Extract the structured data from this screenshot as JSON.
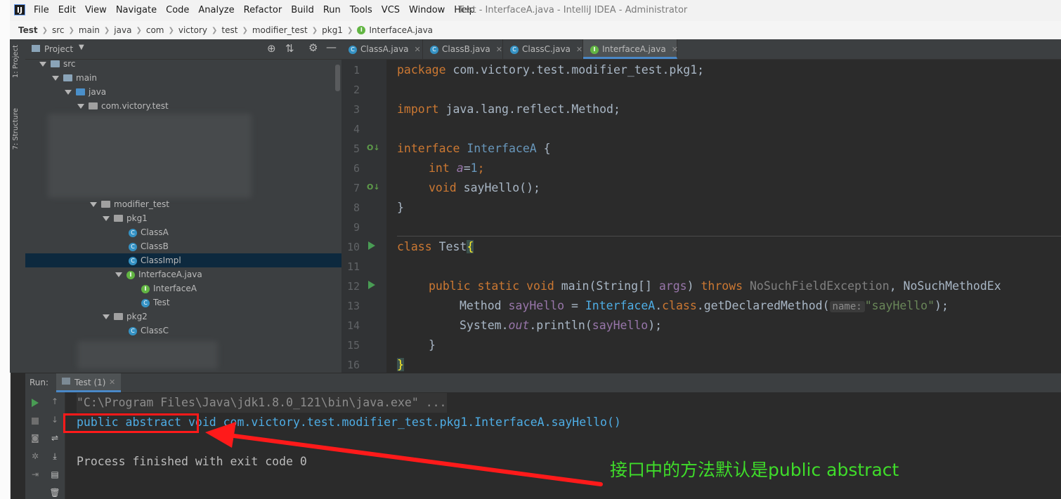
{
  "app": {
    "icon_letter": "IJ",
    "window_title": "Test - InterfaceA.java - IntelliJ IDEA - Administrator"
  },
  "menu": [
    "File",
    "Edit",
    "View",
    "Navigate",
    "Code",
    "Analyze",
    "Refactor",
    "Build",
    "Run",
    "Tools",
    "VCS",
    "Window",
    "Help"
  ],
  "breadcrumb": [
    "Test",
    "src",
    "main",
    "java",
    "com",
    "victory",
    "test",
    "modifier_test",
    "pkg1",
    "InterfaceA.java"
  ],
  "side_tabs": [
    "1: Project",
    "7: Structure"
  ],
  "project_panel": {
    "title": "Project",
    "tree": {
      "src": "src",
      "main": "main",
      "java": "java",
      "pkg_root": "com.victory.test",
      "modifier_test": "modifier_test",
      "pkg1": "pkg1",
      "classA": "ClassA",
      "classB": "ClassB",
      "classImpl": "ClassImpl",
      "interfaceA_file": "InterfaceA.java",
      "interfaceA": "InterfaceA",
      "test": "Test",
      "pkg2": "pkg2",
      "classC": "ClassC"
    }
  },
  "editor_tabs": [
    {
      "label": "ClassA.java",
      "icon": "class-icon"
    },
    {
      "label": "ClassB.java",
      "icon": "class-icon"
    },
    {
      "label": "ClassC.java",
      "icon": "class-icon"
    },
    {
      "label": "InterfaceA.java",
      "icon": "interface-icon",
      "active": true
    }
  ],
  "code_lines": [
    "1",
    "2",
    "3",
    "4",
    "5",
    "6",
    "7",
    "8",
    "9",
    "10",
    "11",
    "12",
    "13",
    "14",
    "15",
    "16"
  ],
  "code": {
    "l1_kw": "package",
    "l1_rest": " com.victory.test.modifier_test.pkg1;",
    "l3_kw": "import",
    "l3_rest": " java.lang.reflect.Method;",
    "l5_kw": "interface",
    "l5_name": "InterfaceA",
    "l5_brace": " {",
    "l6_kw": "int",
    "l6_var": "a",
    "l6_eq": "=",
    "l6_num": "1",
    "l6_end": ";",
    "l7_kw": "void",
    "l7_rest": " sayHello();",
    "l8": "}",
    "l10_kw": "class",
    "l10_name": " Test",
    "l10_brace": "{",
    "l12_kw": "public static void",
    "l12_name": " main(String[] ",
    "l12_param": "args",
    "l12_close": ") ",
    "l12_throws": "throws",
    "l12_exc1": " NoSuchFieldException",
    "l12_comma": ", NoSuchMethodEx",
    "l13_type": "Method ",
    "l13_var": "sayHello",
    "l13_eq": " = ",
    "l13_cls": "InterfaceA",
    "l13_dot": ".",
    "l13_kw": "class",
    "l13_call": ".getDeclaredMethod(",
    "l13_hint": "name:",
    "l13_str": "\"sayHello\"",
    "l13_end": ");",
    "l14_a": "System.",
    "l14_out": "out",
    "l14_b": ".println(",
    "l14_var": "sayHello",
    "l14_c": ");",
    "l15": "}",
    "l16": "}"
  },
  "run_panel": {
    "label": "Run:",
    "tab": "Test (1)",
    "output": {
      "cmd": "\"C:\\Program Files\\Java\\jdk1.8.0_121\\bin\\java.exe\" ...",
      "mods": "public abstract",
      "rest": " void com.victory.test.modifier_test.pkg1.InterfaceA.sayHello()",
      "finished": "Process finished with exit code 0"
    }
  },
  "annotation": "接口中的方法默认是public abstract",
  "colors": {
    "annotation": "#3fdc2a",
    "highlight_box": "#ff1a1a",
    "keyword": "#cc7832",
    "output_text": "#4eade5"
  }
}
